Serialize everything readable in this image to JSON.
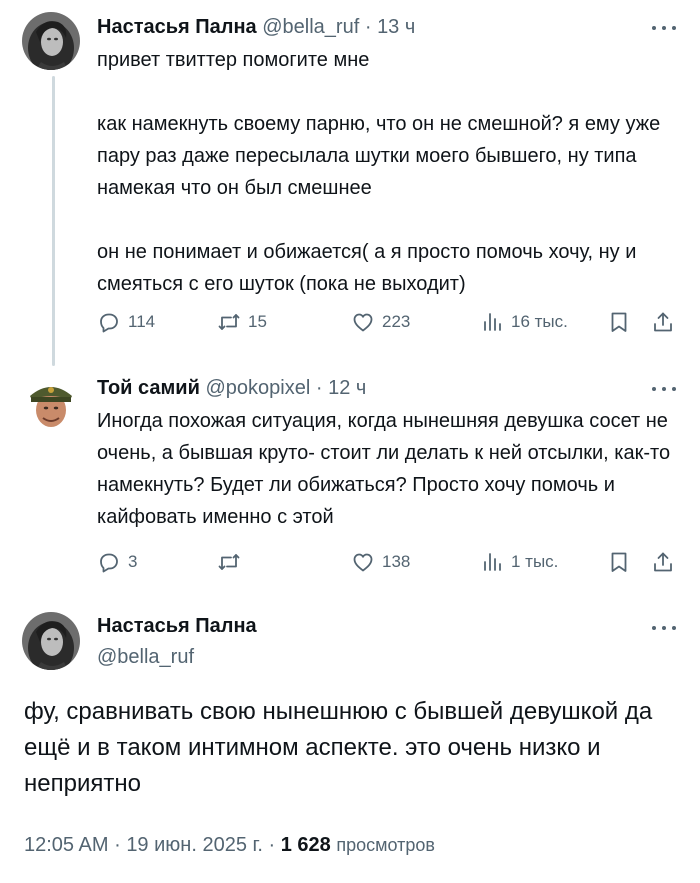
{
  "tweet1": {
    "author_name": "Настасья Пална",
    "handle": "@bella_ruf",
    "separator": "·",
    "time": "13 ч",
    "text": "привет твиттер помогите мне\n\nкак намекнуть своему парню, что он не смешной? я ему уже пару раз даже пересылала шутки моего бывшего, ну типа намекая что он был смешнее\n\nон не понимает и обижается( а я просто помочь хочу, ну и смеяться с его шуток (пока не выходит)",
    "replies": "114",
    "reposts": "15",
    "likes": "223",
    "views": "16 тыс."
  },
  "tweet2": {
    "author_name": "Той самий",
    "handle": "@pokopixel",
    "separator": "·",
    "time": "12 ч",
    "text": "Иногда похожая ситуация, когда нынешняя девушка сосет не очень, а бывшая круто- стоит ли делать к ней отсылки, как-то намекнуть? Будет ли обижаться? Просто хочу помочь и кайфовать именно с этой",
    "replies": "3",
    "reposts": "",
    "likes": "138",
    "views": "1 тыс."
  },
  "main_tweet": {
    "author_name": "Настасья Пална",
    "handle": "@bella_ruf",
    "text": "фу, сравнивать свою нынешнюю с бывшей девушкой да ещё и в таком интимном аспекте. это очень низко и неприятно",
    "time": "12:05 AM",
    "separator": "·",
    "date": "19 июн. 2025 г.",
    "views_count": "1 628",
    "views_label": "просмотров"
  },
  "icons": {
    "reply": "reply-icon",
    "repost": "repost-icon",
    "like": "heart-icon",
    "views": "views-icon",
    "bookmark": "bookmark-icon",
    "share": "share-icon",
    "more": "more-icon"
  },
  "colors": {
    "text": "#0f1419",
    "secondary": "#536471",
    "thread_line": "#cfd9de"
  }
}
